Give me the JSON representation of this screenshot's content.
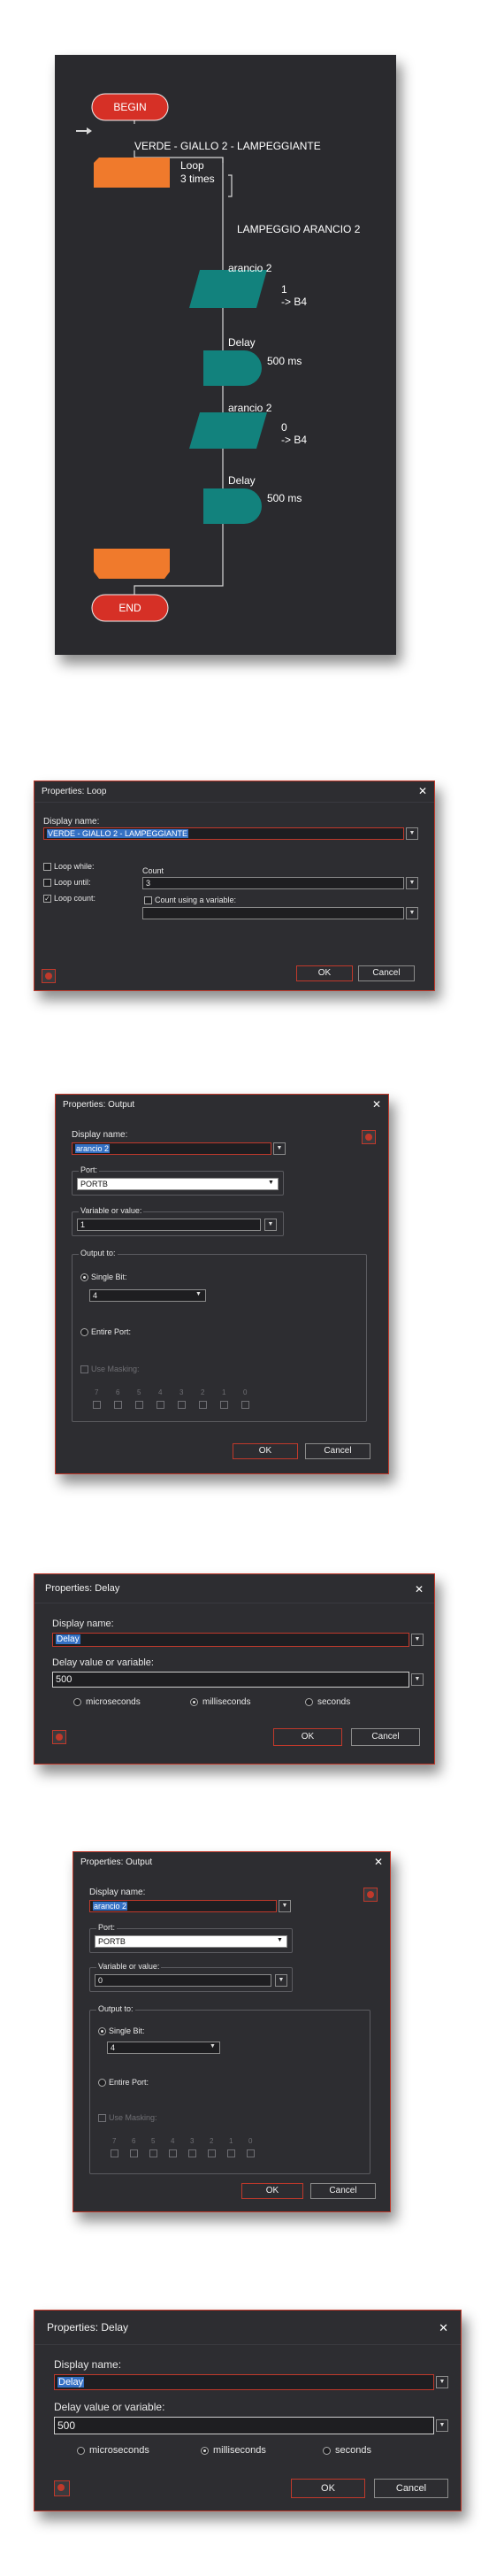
{
  "flowchart": {
    "begin": "BEGIN",
    "end": "END",
    "loop_name": "VERDE - GIALLO  2 - LAMPEGGIANTE",
    "loop_label": "Loop",
    "loop_count": "3 times",
    "comment": "LAMPEGGIO ARANCIO 2",
    "output1_name": "arancio 2",
    "output1_value": "1",
    "output1_target": "-> B4",
    "delay1_label": "Delay",
    "delay1_value": "500 ms",
    "output2_name": "arancio 2",
    "output2_value": "0",
    "output2_target": "-> B4",
    "delay2_label": "Delay",
    "delay2_value": "500 ms",
    "colors": {
      "terminal": "#d63026",
      "loop": "#f07a2c",
      "output": "#12827d",
      "delay": "#12827d"
    }
  },
  "loop_dialog": {
    "title": "Properties: Loop",
    "close": "✕",
    "display_name_label": "Display name:",
    "display_name": "VERDE - GIALLO  2 - LAMPEGGIANTE",
    "loop_while": "Loop while:",
    "loop_until": "Loop until:",
    "loop_count": "Loop count:",
    "count_label": "Count",
    "count_value": "3",
    "count_using_variable": "Count using a variable:",
    "ok": "OK",
    "cancel": "Cancel"
  },
  "output_dialog_1": {
    "title": "Properties: Output",
    "close": "✕",
    "display_name_label": "Display name:",
    "display_name": "arancio 2",
    "port_label": "Port:",
    "port_value": "PORTB",
    "variable_label": "Variable or value:",
    "variable_value": "1",
    "output_to_label": "Output to:",
    "single_bit": "Single Bit:",
    "bit_value": "4",
    "entire_port": "Entire Port:",
    "use_masking": "Use Masking:",
    "bits": [
      "7",
      "6",
      "5",
      "4",
      "3",
      "2",
      "1",
      "0"
    ],
    "ok": "OK",
    "cancel": "Cancel"
  },
  "delay_dialog_1": {
    "title": "Properties: Delay",
    "close": "✕",
    "display_name_label": "Display name:",
    "display_name": "Delay",
    "delay_label": "Delay value or variable:",
    "delay_value": "500",
    "microseconds": "microseconds",
    "milliseconds": "milliseconds",
    "seconds": "seconds",
    "ok": "OK",
    "cancel": "Cancel"
  },
  "output_dialog_2": {
    "title": "Properties: Output",
    "close": "✕",
    "display_name_label": "Display name:",
    "display_name": "arancio 2",
    "port_label": "Port:",
    "port_value": "PORTB",
    "variable_label": "Variable or value:",
    "variable_value": "0",
    "output_to_label": "Output to:",
    "single_bit": "Single Bit:",
    "bit_value": "4",
    "entire_port": "Entire Port:",
    "use_masking": "Use Masking:",
    "bits": [
      "7",
      "6",
      "5",
      "4",
      "3",
      "2",
      "1",
      "0"
    ],
    "ok": "OK",
    "cancel": "Cancel"
  },
  "delay_dialog_2": {
    "title": "Properties: Delay",
    "close": "✕",
    "display_name_label": "Display name:",
    "display_name": "Delay",
    "delay_label": "Delay value or variable:",
    "delay_value": "500",
    "microseconds": "microseconds",
    "milliseconds": "milliseconds",
    "seconds": "seconds",
    "ok": "OK",
    "cancel": "Cancel"
  }
}
